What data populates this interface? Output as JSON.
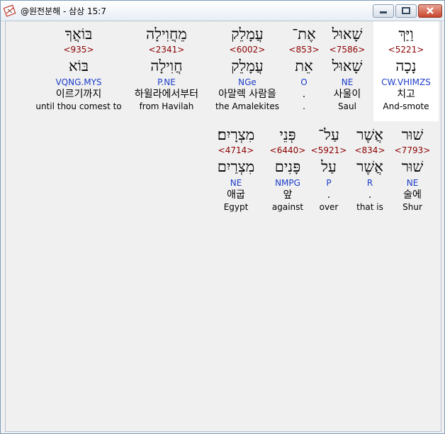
{
  "window": {
    "title": "@원전분해 - 삼상 15:7",
    "app_icon": "bible-icon"
  },
  "rows": [
    {
      "words": [
        {
          "heb": "וַיַּךְ",
          "strong": "<5221>",
          "lemma": "נָכָה",
          "parse": "CW.VHIMZS",
          "kor": "치고",
          "eng": "And-smote",
          "highlighted": true
        },
        {
          "heb": "שָׁאוּל",
          "strong": "<7586>",
          "lemma": "שָׁאוּל",
          "parse": "NE",
          "kor": "사울이",
          "eng": "Saul"
        },
        {
          "heb": "אֶת־",
          "strong": "<853>",
          "lemma": "אֵת",
          "parse": "O",
          "kor": ".",
          "eng": "."
        },
        {
          "heb": "עֲמָלֵק",
          "strong": "<6002>",
          "lemma": "עֲמָלֵק",
          "parse": "NGe",
          "kor": "아말렉 사람을",
          "eng": "the Amalekites"
        },
        {
          "heb": "מֵחֲוִילָה",
          "strong": "<2341>",
          "lemma": "חֲוִילָה",
          "parse": "P.NE",
          "kor": "하윌라에서부터",
          "eng": "from Havilah"
        },
        {
          "heb": "בּוֹאֲךָ",
          "strong": "<935>",
          "lemma": "בּוֹא",
          "parse": "VQNG.MYS",
          "kor": "이르기까지",
          "eng": "until thou comest to"
        }
      ]
    },
    {
      "words": [
        {
          "heb": "שׁוּר",
          "strong": "<7793>",
          "lemma": "שׁוּר",
          "parse": "NE",
          "kor": "술에",
          "eng": "Shur"
        },
        {
          "heb": "אֲשֶׁר",
          "strong": "<834>",
          "lemma": "אֲשֶׁר",
          "parse": "R",
          "kor": ".",
          "eng": "that is"
        },
        {
          "heb": "עַל־",
          "strong": "<5921>",
          "lemma": "עַל",
          "parse": "P",
          "kor": ".",
          "eng": "over"
        },
        {
          "heb": "פְּנֵי",
          "strong": "<6440>",
          "lemma": "פָּנִים",
          "parse": "NMPG",
          "kor": "앞",
          "eng": "against"
        },
        {
          "heb": "מִצְרָיִם׃",
          "strong": "<4714>",
          "lemma": "מִצְרַיִם",
          "parse": "NE",
          "kor": "애굽",
          "eng": "Egypt"
        }
      ]
    }
  ]
}
